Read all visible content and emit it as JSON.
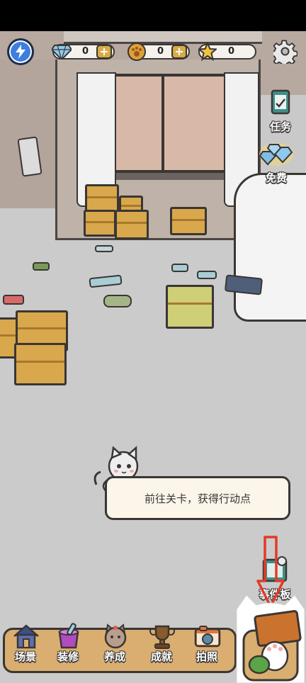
{
  "currencies": {
    "diamond": {
      "icon": "diamond-icon",
      "value": "0"
    },
    "paw_coin": {
      "icon": "paw-coin-icon",
      "value": "0"
    },
    "star": {
      "icon": "star-icon",
      "value": "0"
    }
  },
  "side_buttons": {
    "task": {
      "label": "任务",
      "icon": "task-board-icon"
    },
    "free": {
      "label": "免费",
      "icon": "diamond-pile-icon"
    },
    "event": {
      "label": "事件板",
      "icon": "event-board-icon"
    }
  },
  "tooltip": {
    "text": "前往关卡，获得行动点"
  },
  "bottom_nav": [
    {
      "label": "场景",
      "icon": "house-icon"
    },
    {
      "label": "装修",
      "icon": "paint-bucket-icon"
    },
    {
      "label": "养成",
      "icon": "cat-face-icon"
    },
    {
      "label": "成就",
      "icon": "trophy-icon"
    },
    {
      "label": "拍照",
      "icon": "camera-icon"
    }
  ],
  "colors": {
    "accent_plus": "#d9ab45",
    "nav_bar": "#d9ae70",
    "tooltip_bg": "#fbf5ea",
    "energy": "#3d7fe0",
    "arrow": "#e23a2a"
  }
}
